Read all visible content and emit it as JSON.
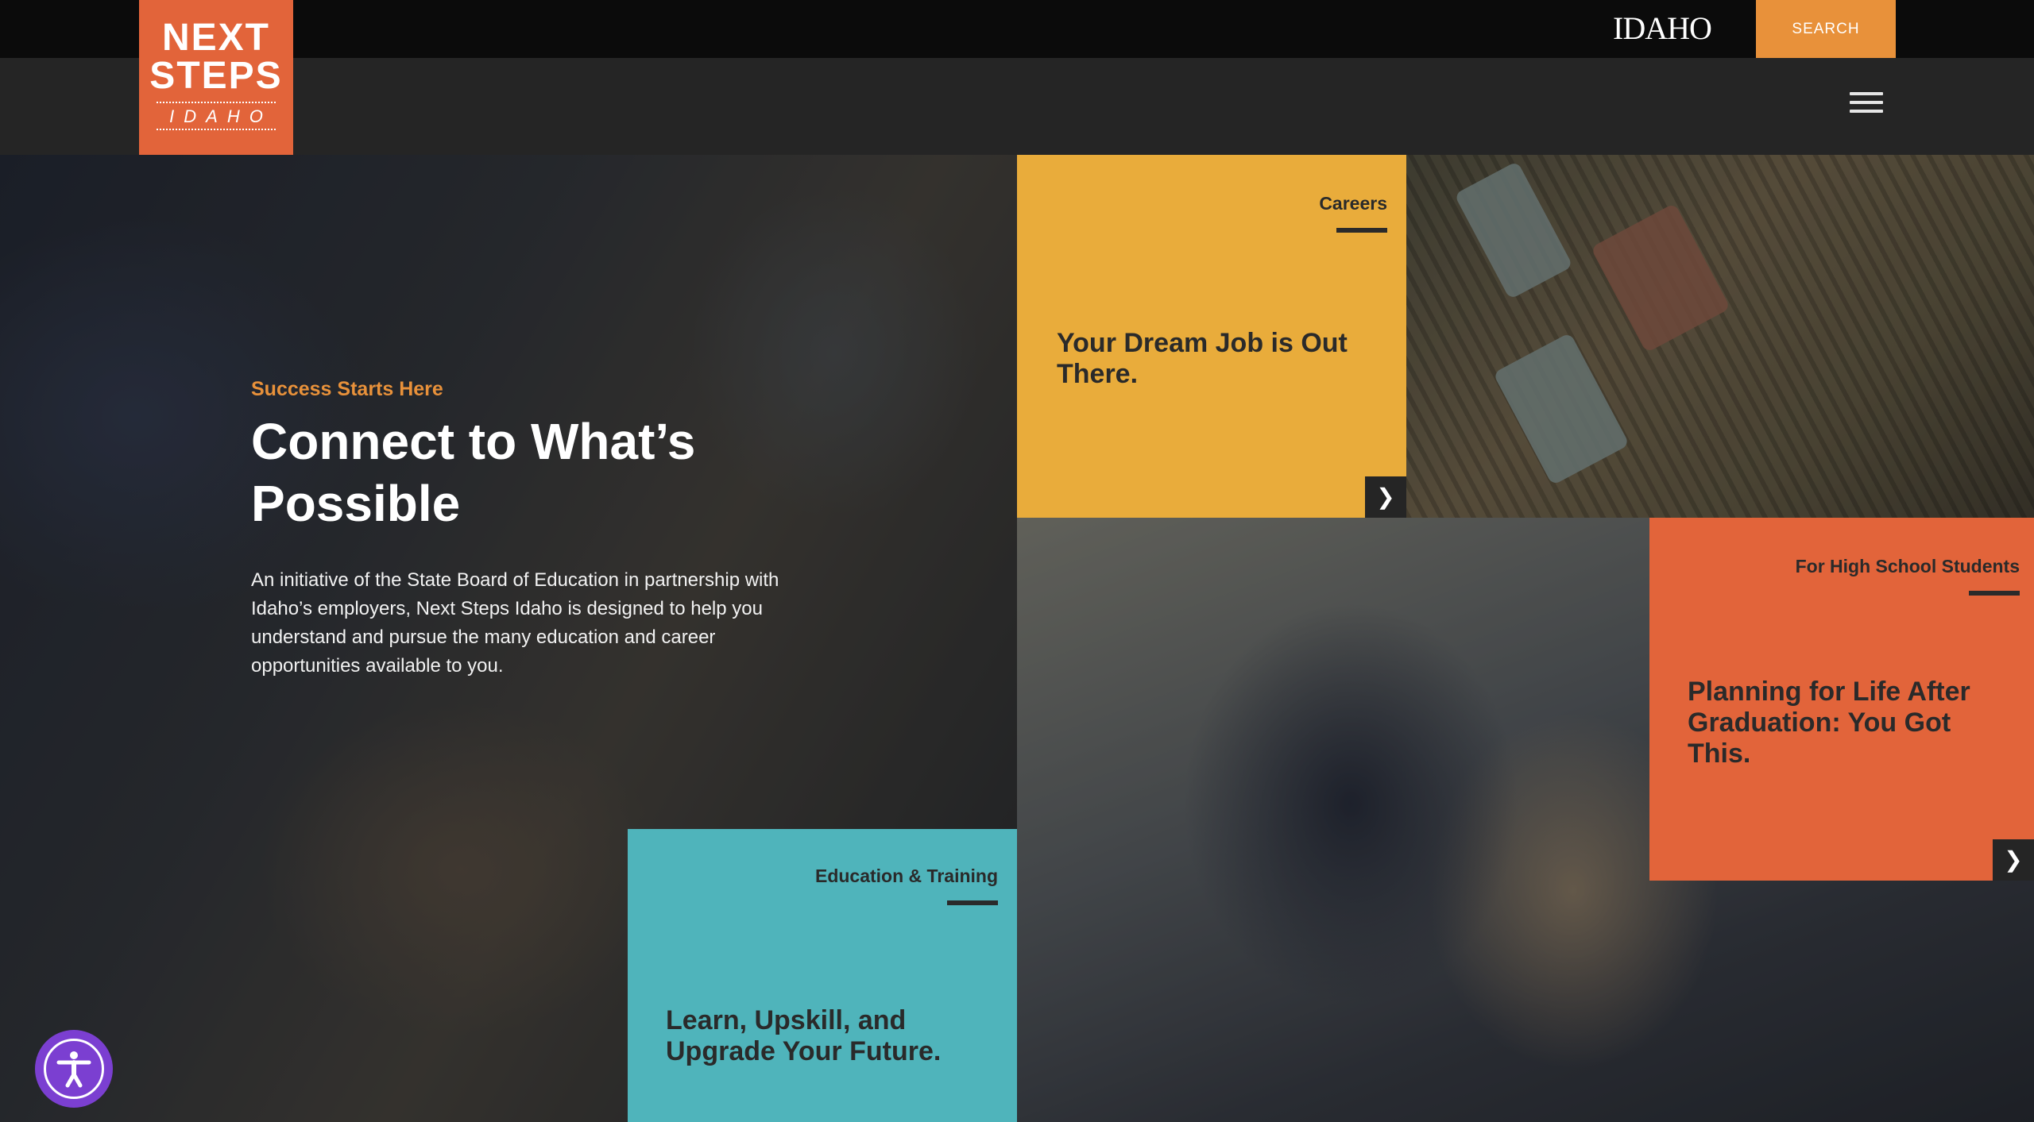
{
  "topbar": {
    "state_logo": "IDAHO",
    "search_label": "SEARCH"
  },
  "brand": {
    "line1": "NEXT",
    "line2": "STEPS",
    "line3": "IDAHO"
  },
  "hero": {
    "eyebrow": "Success Starts Here",
    "title": "Connect to What’s Possible",
    "description": "An initiative of the State Board of Education in partnership with Idaho’s employers, Next Steps Idaho is designed to help you understand and pursue the many education and career opportunities available to you."
  },
  "tiles": {
    "careers": {
      "label": "Careers",
      "title": "Your Dream Job is Out There."
    },
    "high_school": {
      "label": "For High School Students",
      "title": "Planning for Life After Graduation: You Got This."
    },
    "education": {
      "label": "Education & Training",
      "title": "Learn, Upskill, and Upgrade Your Future."
    }
  },
  "icons": {
    "arrow": "chevron-right-icon",
    "menu": "hamburger-menu-icon",
    "accessibility": "accessibility-icon"
  },
  "colors": {
    "orange": "#e2643a",
    "gold": "#e9ac3b",
    "teal": "#4fb4bb",
    "search": "#e8913a",
    "a11y": "#7b3fd1"
  }
}
